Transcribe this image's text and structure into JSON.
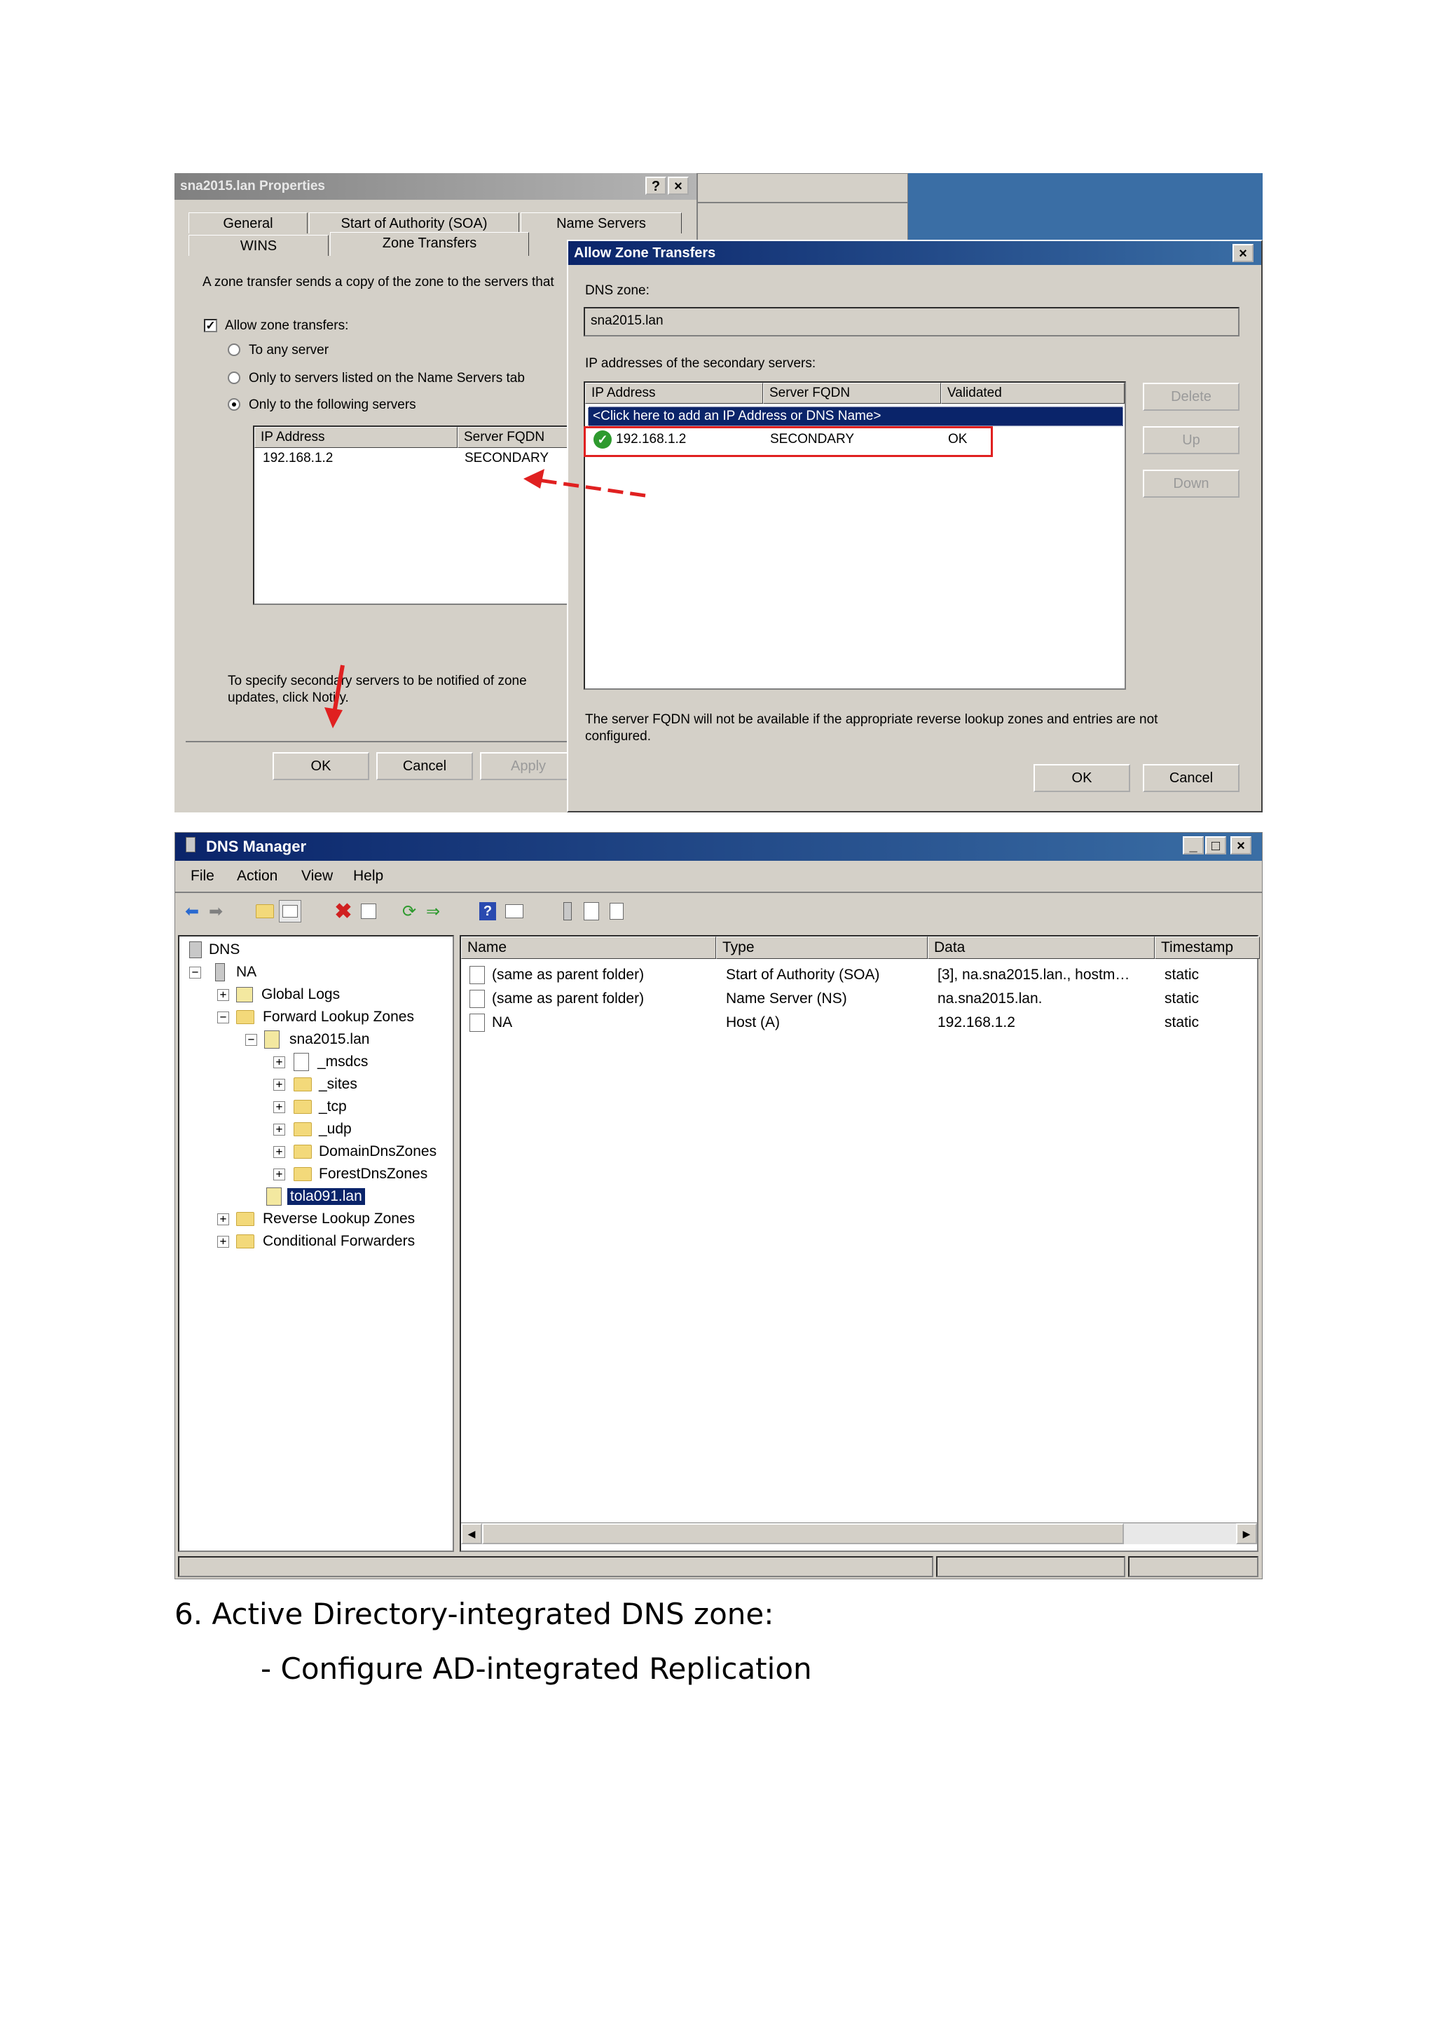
{
  "fig1": {
    "props": {
      "title": "sna2015.lan Properties",
      "title_help": "?",
      "title_close": "×",
      "tabs_row1": [
        "General",
        "Start of Authority (SOA)",
        "Name Servers"
      ],
      "tabs_row2": [
        "WINS",
        "Zone Transfers"
      ],
      "intro": "A zone transfer sends a copy of the zone to the servers that",
      "allow_label": "Allow zone transfers:",
      "allow_checked": "✓",
      "radio_any": "To any server",
      "radio_ns": "Only to servers listed on the Name Servers tab",
      "radio_following": "Only to the following servers",
      "col_ip": "IP Address",
      "col_fqdn": "Server FQDN",
      "row_ip": "192.168.1.2",
      "row_fqdn": "SECONDARY",
      "notify_text_1": "To specify secondary servers to be notified of zone",
      "notify_text_2": "updates, click Notify.",
      "btn_ok": "OK",
      "btn_cancel": "Cancel",
      "btn_apply": "Apply"
    },
    "azt": {
      "title": "Allow Zone Transfers",
      "title_close": "×",
      "dns_zone_label": "DNS zone:",
      "dns_zone_value": "sna2015.lan",
      "secondary_label": "IP addresses of the secondary servers:",
      "col_ip": "IP Address",
      "col_fqdn": "Server FQDN",
      "col_validated": "Validated",
      "add_row": "<Click here to add an IP Address or DNS Name>",
      "row_ip": "192.168.1.2",
      "row_fqdn": "SECONDARY",
      "row_validated": "OK",
      "btn_delete": "Delete",
      "btn_up": "Up",
      "btn_down": "Down",
      "note_1": "The server FQDN will not be available if the appropriate reverse lookup zones and entries are not",
      "note_2": "configured.",
      "btn_ok": "OK",
      "btn_cancel": "Cancel"
    },
    "annotation_color": "#e02020"
  },
  "fig2": {
    "title": "DNS Manager",
    "menus": [
      "File",
      "Action",
      "View",
      "Help"
    ],
    "toolbar_icons": [
      "back-arrow",
      "forward-arrow",
      "up-folder",
      "show-hide-tree",
      "delete-x",
      "properties",
      "refresh",
      "export-list",
      "help",
      "console-view",
      "server",
      "list-view",
      "copy"
    ],
    "tree": {
      "root": "DNS",
      "server": "NA",
      "global_logs": "Global Logs",
      "forward_zones": "Forward Lookup Zones",
      "zone_sna": "sna2015.lan",
      "children": [
        "_msdcs",
        "_sites",
        "_tcp",
        "_udp",
        "DomainDnsZones",
        "ForestDnsZones"
      ],
      "zone_tola": "tola091.lan",
      "reverse_zones": "Reverse Lookup Zones",
      "conditional": "Conditional Forwarders"
    },
    "columns": [
      "Name",
      "Type",
      "Data",
      "Timestamp"
    ],
    "rows": [
      {
        "name": "(same as parent folder)",
        "type": "Start of Authority (SOA)",
        "data": "[3], na.sna2015.lan., hostm…",
        "ts": "static"
      },
      {
        "name": "(same as parent folder)",
        "type": "Name Server (NS)",
        "data": "na.sna2015.lan.",
        "ts": "static"
      },
      {
        "name": "NA",
        "type": "Host (A)",
        "data": "192.168.1.2",
        "ts": "static"
      }
    ],
    "win_min": "_",
    "win_max": "□",
    "win_close": "×"
  },
  "captions": {
    "heading": "6. Active Directory-integrated DNS zone:",
    "sub": "- Configure AD-integrated Replication"
  }
}
